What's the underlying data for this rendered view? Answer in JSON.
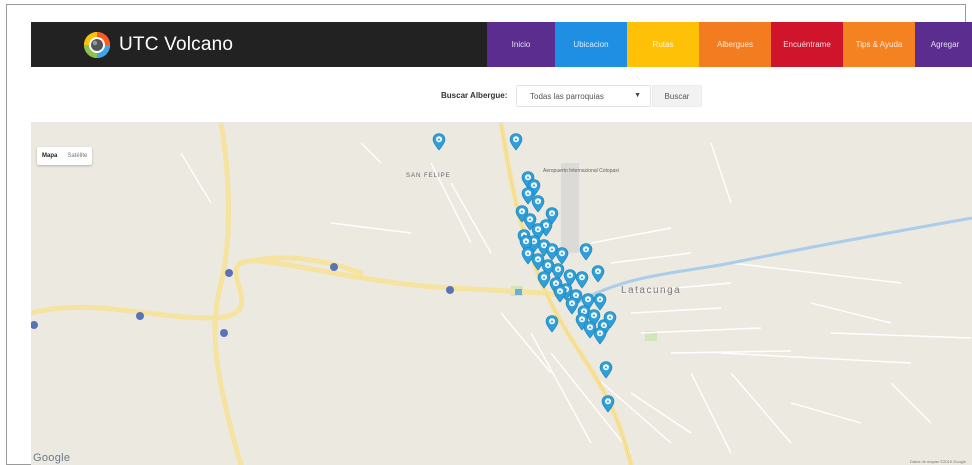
{
  "brand": {
    "name": "UTC Volcano",
    "logo_icon": "volcano-logo-icon"
  },
  "nav": {
    "items": [
      {
        "label": "Inicio",
        "color": "#5b2d8e",
        "width": 68
      },
      {
        "label": "Ubicacion",
        "color": "#1e8fe3",
        "width": 72
      },
      {
        "label": "Rutas",
        "color": "#ffc107",
        "width": 72
      },
      {
        "label": "Albergues",
        "color": "#f47c20",
        "width": 72
      },
      {
        "label": "Encuéntrame",
        "color": "#d0142c",
        "width": 72
      },
      {
        "label": "Tips & Ayuda",
        "color": "#f58220",
        "width": 72
      },
      {
        "label": "Agregar",
        "color": "#5b2d8e",
        "width": 60
      }
    ]
  },
  "search": {
    "label": "Buscar Albergue:",
    "select_value": "Todas las parroquias",
    "button_label": "Buscar"
  },
  "map": {
    "type_control": {
      "map": "Mapa",
      "satellite": "Satélite"
    },
    "labels": {
      "san_felipe": "SAN FELIPE",
      "aeropuerto": "Aeropuerto Internacional Cotopaxi",
      "latacunga": "Latacunga"
    },
    "google": "Google",
    "attribution": "Datos de mapas ©2019 Google",
    "marker_color": "#2e9fd8"
  }
}
